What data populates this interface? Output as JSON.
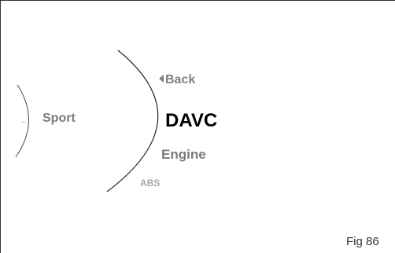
{
  "menu": {
    "previous_indicator": "...",
    "previous_item": "Sport",
    "back_label": "Back",
    "back_icon": "triangle-left-icon",
    "selected_item": "DAVC",
    "next_item": "Engine",
    "next_next_item": "ABS"
  },
  "caption": "Fig 86"
}
